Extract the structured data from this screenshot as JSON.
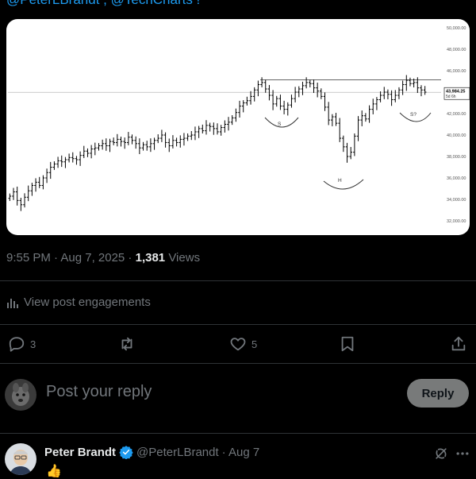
{
  "tweet": {
    "header_text": "@PeterLBrandt , @TechCharts !",
    "timestamp": "9:55 PM · Aug 7, 2025 · ",
    "views_count": "1,381",
    "views_label": " Views",
    "engagements_label": "View post engagements"
  },
  "chart_data": {
    "type": "bar",
    "y_ticks": [
      "50,000.00",
      "48,000.00",
      "46,000.00",
      "44,000.00",
      "42,000.00",
      "40,000.00",
      "38,000.00",
      "36,000.00",
      "34,000.00",
      "32,000.00"
    ],
    "ylim": [
      31500,
      50500
    ],
    "price_label": "43,984.25",
    "price_sub": "5d 6h",
    "current_price": 43984.25,
    "neckline": 45150,
    "annotations": [
      "S",
      "H",
      "S?"
    ],
    "closes": [
      34300,
      34700,
      33900,
      33500,
      34200,
      34800,
      35300,
      35600,
      35300,
      36000,
      36500,
      37000,
      37300,
      37600,
      37500,
      37700,
      37900,
      37800,
      37700,
      38100,
      38500,
      38300,
      38700,
      38800,
      39000,
      39200,
      39000,
      39400,
      39300,
      39600,
      39400,
      39300,
      39800,
      39500,
      39200,
      38800,
      39100,
      38900,
      39200,
      39500,
      39700,
      40000,
      39300,
      39000,
      39500,
      39300,
      39600,
      39700,
      39900,
      40000,
      40300,
      40600,
      40400,
      40900,
      40800,
      40600,
      40300,
      40700,
      41000,
      41200,
      41600,
      42100,
      42700,
      43000,
      43200,
      43600,
      44200,
      44700,
      44900,
      44300,
      43700,
      42900,
      43400,
      42700,
      42400,
      42800,
      43400,
      44000,
      44300,
      44600,
      44900,
      44800,
      44400,
      44100,
      43600,
      42600,
      41400,
      41700,
      41100,
      39700,
      38900,
      38000,
      38400,
      39900,
      41400,
      41800,
      41500,
      42400,
      42900,
      43300,
      43700,
      44000,
      43800,
      43300,
      43700,
      44200,
      44700,
      45100,
      44800,
      44900,
      44400,
      44200,
      44000
    ]
  },
  "actions": {
    "reply_count": "3",
    "repost_count": "",
    "like_count": "5"
  },
  "reply_box": {
    "placeholder": "Post your reply",
    "button_label": "Reply"
  },
  "reply_tweet": {
    "author_name": "Peter Brandt",
    "handle": "@PeterLBrandt",
    "date": " · Aug 7",
    "content": "👍"
  },
  "colors": {
    "accent": "#1d9bf0",
    "muted": "#71767b",
    "divider": "#2f3336",
    "reply_button": "#787a7a"
  }
}
